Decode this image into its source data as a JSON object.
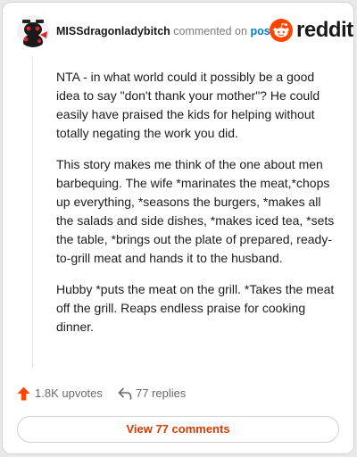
{
  "header": {
    "username": "MISSdragonladybitch",
    "action_text": " commented on ",
    "post_link": "post",
    "logo_text": "reddit"
  },
  "comment": {
    "paragraphs": [
      "NTA - in what world could it possibly be a good idea to say \"don't thank your mother\"? He could easily have praised the kids for helping without totally negating the work you did.",
      "This story makes me think of the one about men barbequing. The wife *marinates the meat,*chops up everything, *seasons the burgers, *makes all the salads and side dishes, *makes iced tea, *sets the table, *brings out the plate of prepared, ready-to-grill meat and hands it to the husband.",
      "Hubby *puts the meat on the grill. *Takes the meat off the grill. Reaps endless praise for cooking dinner."
    ]
  },
  "actions": {
    "upvotes": "1.8K upvotes",
    "replies": "77 replies"
  },
  "footer": {
    "view_comments": "View 77 comments"
  },
  "icons": {
    "avatar": "snoo-avatar-icon",
    "logo": "reddit-logo-icon",
    "upvote": "upvote-arrow-icon",
    "reply": "reply-arrow-icon"
  },
  "colors": {
    "brand": "#ff4500",
    "link": "#0079d3",
    "view_comments": "#d93a00"
  }
}
